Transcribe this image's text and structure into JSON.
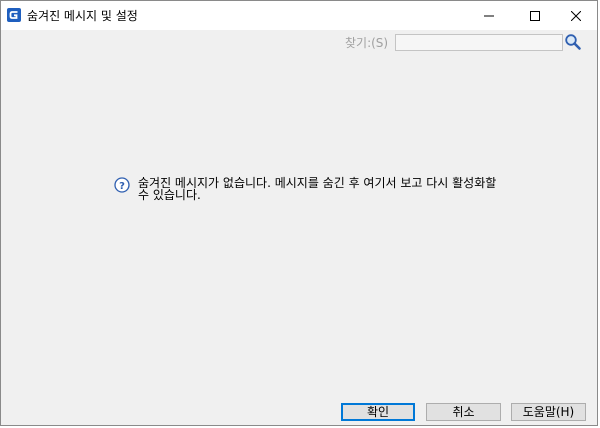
{
  "window": {
    "title": "숨겨진 메시지 및 설정"
  },
  "search": {
    "label": "찾기:(S)",
    "value": "",
    "placeholder": ""
  },
  "main": {
    "message": "숨겨진 메시지가 없습니다. 메시지를 숨긴 후 여기서 보고 다시 활성화할 수 있습니다."
  },
  "buttons": {
    "ok": "확인",
    "cancel": "취소",
    "help": "도움말(H)"
  },
  "colors": {
    "accent": "#0078d7",
    "icon_blue": "#2f5fb0"
  }
}
